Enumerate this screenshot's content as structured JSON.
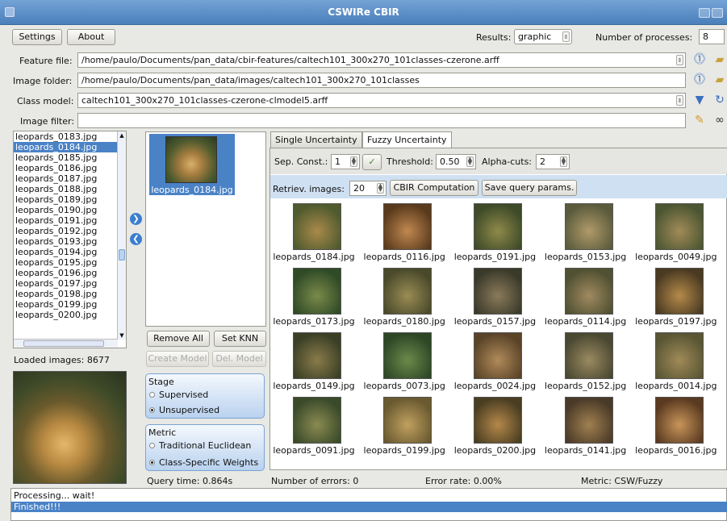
{
  "window": {
    "title": "CSWIRe CBIR"
  },
  "menu": {
    "settings": "Settings",
    "about": "About",
    "results_label": "Results:",
    "results_value": "graphic",
    "processes_label": "Number of processes:",
    "processes_value": "8"
  },
  "paths": {
    "feature_label": "Feature file:",
    "feature_value": "/home/paulo/Documents/pan_data/cbir-features/caltech101_300x270_101classes-czerone.arff",
    "folder_label": "Image folder:",
    "folder_value": "/home/paulo/Documents/pan_data/images/caltech101_300x270_101classes",
    "model_label": "Class model:",
    "model_value": "caltech101_300x270_101classes-czerone-clmodel5.arff",
    "filter_label": "Image filter:",
    "filter_value": ""
  },
  "image_list": [
    "leopards_0183.jpg",
    "leopards_0184.jpg",
    "leopards_0185.jpg",
    "leopards_0186.jpg",
    "leopards_0187.jpg",
    "leopards_0188.jpg",
    "leopards_0189.jpg",
    "leopards_0190.jpg",
    "leopards_0191.jpg",
    "leopards_0192.jpg",
    "leopards_0193.jpg",
    "leopards_0194.jpg",
    "leopards_0195.jpg",
    "leopards_0196.jpg",
    "leopards_0197.jpg",
    "leopards_0198.jpg",
    "leopards_0199.jpg",
    "leopards_0200.jpg"
  ],
  "selected_image": "leopards_0184.jpg",
  "loaded_images": "Loaded images: 8677",
  "query": {
    "image_name": "leopards_0184.jpg",
    "remove_all": "Remove All",
    "set_knn": "Set KNN",
    "create_model": "Create Model",
    "del_model": "Del. Model",
    "query_time": "Query time: 0.864s"
  },
  "stage": {
    "title": "Stage",
    "supervised": "Supervised",
    "unsupervised": "Unsupervised",
    "selected": "Unsupervised"
  },
  "metric": {
    "title": "Metric",
    "euclidean": "Traditional Euclidean",
    "csw": "Class-Specific Weights",
    "selected": "Class-Specific Weights"
  },
  "tabs": {
    "single": "Single Uncertainty",
    "fuzzy": "Fuzzy Uncertainty",
    "active": "Fuzzy Uncertainty"
  },
  "params": {
    "sep_label": "Sep. Const.:",
    "sep_value": "1",
    "threshold_label": "Threshold:",
    "threshold_value": "0.50",
    "alpha_label": "Alpha-cuts:",
    "alpha_value": "2",
    "retriev_label": "Retriev. images:",
    "retriev_value": "20",
    "cbir_button": "CBIR Computation",
    "save_button": "Save query params."
  },
  "results": [
    "leopards_0184.jpg",
    "leopards_0116.jpg",
    "leopards_0191.jpg",
    "leopards_0153.jpg",
    "leopards_0049.jpg",
    "leopards_0173.jpg",
    "leopards_0180.jpg",
    "leopards_0157.jpg",
    "leopards_0114.jpg",
    "leopards_0197.jpg",
    "leopards_0149.jpg",
    "leopards_0073.jpg",
    "leopards_0024.jpg",
    "leopards_0152.jpg",
    "leopards_0014.jpg",
    "leopards_0091.jpg",
    "leopards_0199.jpg",
    "leopards_0200.jpg",
    "leopards_0141.jpg",
    "leopards_0016.jpg"
  ],
  "stats": {
    "errors": "Number of errors: 0",
    "error_rate": "Error rate: 0.00%",
    "metric": "Metric: CSW/Fuzzy"
  },
  "log": {
    "line1": "Processing... wait!",
    "line2": "Finished!!!"
  },
  "colors": {
    "titlebar": "#4a7fba",
    "selection": "#4a82c6",
    "group": "#b9d2ef"
  }
}
